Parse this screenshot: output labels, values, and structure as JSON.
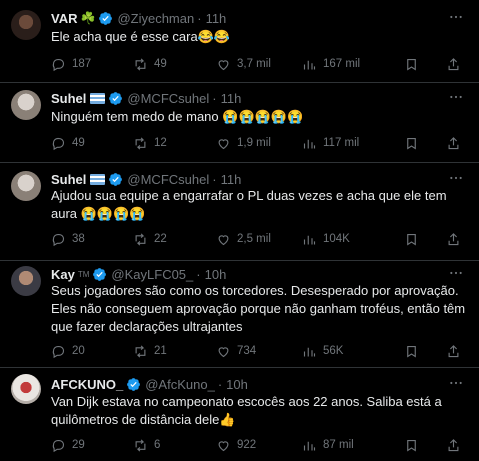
{
  "colors": {
    "background": "#000000",
    "text": "#e7e9ea",
    "muted": "#71767b",
    "verified": "#1d9bf0",
    "divider": "#2f3336"
  },
  "tweets": [
    {
      "name": "VAR",
      "badge": "☘️",
      "handle": "@Ziyechman",
      "dot": "·",
      "time": "11h",
      "verified": true,
      "text": "Ele acha que é esse cara😂😂",
      "replies": "187",
      "retweets": "49",
      "likes": "3,7 mil",
      "views": "167 mil"
    },
    {
      "name": "Suhel",
      "badge": "flag-icon",
      "handle": "@MCFCsuhel",
      "dot": "·",
      "time": "11h",
      "verified": true,
      "text": "Ninguém tem medo de mano 😭😭😭😭😭",
      "replies": "49",
      "retweets": "12",
      "likes": "1,9 mil",
      "views": "117 mil"
    },
    {
      "name": "Suhel",
      "badge": "flag-icon",
      "handle": "@MCFCsuhel",
      "dot": "·",
      "time": "11h",
      "verified": true,
      "text": "Ajudou sua equipe a engarrafar o PL duas vezes e acha que ele tem aura 😭😭😭😭",
      "replies": "38",
      "retweets": "22",
      "likes": "2,5 mil",
      "views": "104K"
    },
    {
      "name": "Kay",
      "badge": "TM",
      "handle": "@KayLFC05_",
      "dot": "·",
      "time": "10h",
      "verified": true,
      "text": "Seus jogadores são como os torcedores. Desesperado por aprovação. Eles não conseguem aprovação porque não ganham troféus, então têm que fazer declarações ultrajantes",
      "replies": "20",
      "retweets": "21",
      "likes": "734",
      "views": "56K"
    },
    {
      "name": "AFCKUNO_",
      "badge": "",
      "handle": "@AfcKuno_",
      "dot": "·",
      "time": "10h",
      "verified": true,
      "text": "Van Dijk estava no campeonato escocês aos 22 anos. Saliba está a quilômetros de distância dele👍",
      "replies": "29",
      "retweets": "6",
      "likes": "922",
      "views": "87 mil"
    }
  ]
}
